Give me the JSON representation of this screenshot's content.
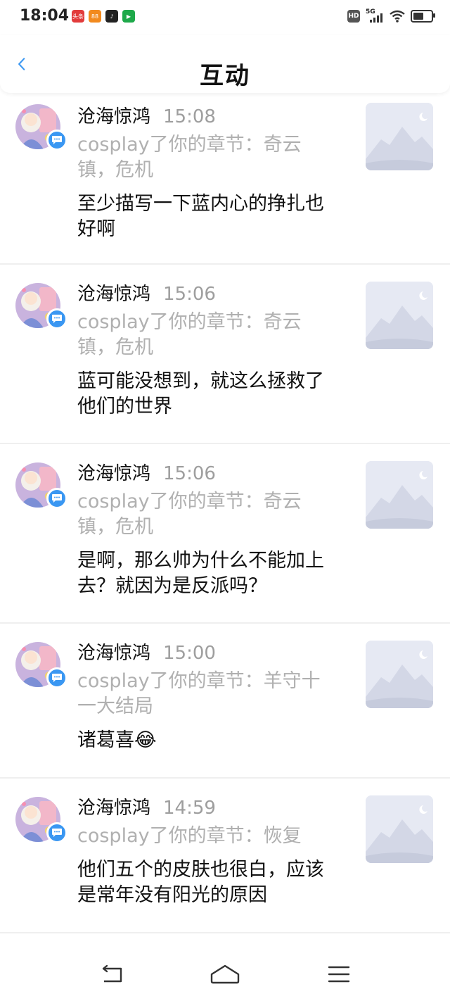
{
  "status_bar": {
    "time": "18:04",
    "apps": [
      {
        "icon": "toutiao-app-icon",
        "label": "头条",
        "color": "#e23b3b"
      },
      {
        "icon": "orange-app-icon",
        "label": "",
        "color": "#f28a1e"
      },
      {
        "icon": "tiktok-app-icon",
        "label": "",
        "color": "#222222"
      },
      {
        "icon": "iqiyi-app-icon",
        "label": "",
        "color": "#1ea94a"
      }
    ],
    "hd_label": "HD",
    "network_label": "5G"
  },
  "header": {
    "title": "互动"
  },
  "notifications": [
    {
      "user": "沧海惊鸿",
      "time": "15:08",
      "context": "cosplay了你的章节：奇云镇，危机",
      "comment": "至少描写一下蓝内心的挣扎也好啊"
    },
    {
      "user": "沧海惊鸿",
      "time": "15:06",
      "context": "cosplay了你的章节：奇云镇，危机",
      "comment": "蓝可能没想到，就这么拯救了他们的世界"
    },
    {
      "user": "沧海惊鸿",
      "time": "15:06",
      "context": "cosplay了你的章节：奇云镇，危机",
      "comment": "是啊，那么帅为什么不能加上去？就因为是反派吗？"
    },
    {
      "user": "沧海惊鸿",
      "time": "15:00",
      "context": "cosplay了你的章节：羊守十一大结局",
      "comment": "诸葛喜😂"
    },
    {
      "user": "沧海惊鸿",
      "time": "14:59",
      "context": "cosplay了你的章节：恢复",
      "comment": "他们五个的皮肤也很白，应该是常年没有阳光的原因"
    }
  ],
  "colors": {
    "accent": "#3a97f2",
    "secondary_text": "#b0b0b0",
    "divider": "#efefef"
  }
}
